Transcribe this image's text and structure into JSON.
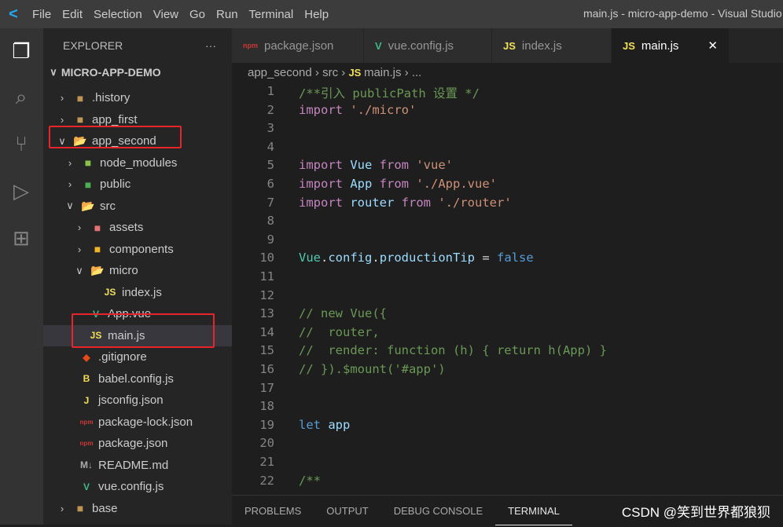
{
  "titlebar": {
    "menus": [
      "File",
      "Edit",
      "Selection",
      "View",
      "Go",
      "Run",
      "Terminal",
      "Help"
    ],
    "title": "main.js - micro-app-demo - Visual Studio Code"
  },
  "explorer": {
    "header": "EXPLORER",
    "more": "···",
    "root": "MICRO-APP-DEMO",
    "items": [
      {
        "label": ".history",
        "level": 1,
        "type": "folder",
        "open": false,
        "icon_color": "#c09553"
      },
      {
        "label": "app_first",
        "level": 1,
        "type": "folder",
        "open": false,
        "icon_color": "#c09553"
      },
      {
        "label": "app_second",
        "level": 1,
        "type": "folder",
        "open": true,
        "icon_color": "#c09553",
        "highlighted": true
      },
      {
        "label": "node_modules",
        "level": 2,
        "type": "folder",
        "open": false,
        "icon_color": "#8bc34a"
      },
      {
        "label": "public",
        "level": 2,
        "type": "folder",
        "open": false,
        "icon_color": "#4caf50"
      },
      {
        "label": "src",
        "level": 2,
        "type": "folder",
        "open": true,
        "icon_color": "#4caf50"
      },
      {
        "label": "assets",
        "level": 3,
        "type": "folder",
        "open": false,
        "icon_color": "#e57373"
      },
      {
        "label": "components",
        "level": 3,
        "type": "folder",
        "open": false,
        "icon_color": "#f0b429"
      },
      {
        "label": "micro",
        "level": 3,
        "type": "folder",
        "open": true,
        "icon_color": "#c09553"
      },
      {
        "label": "index.js",
        "level": 4,
        "type": "file",
        "icon": "JS",
        "icon_color": "#f1e05a"
      },
      {
        "label": "App.vue",
        "level": 3,
        "type": "file",
        "icon": "V",
        "icon_color": "#41b883"
      },
      {
        "label": "main.js",
        "level": 3,
        "type": "file",
        "icon": "JS",
        "icon_color": "#f1e05a",
        "selected": true,
        "highlighted": true
      },
      {
        "label": ".gitignore",
        "level": 2,
        "type": "file",
        "icon": "◆",
        "icon_color": "#e64a19"
      },
      {
        "label": "babel.config.js",
        "level": 2,
        "type": "file",
        "icon": "B",
        "icon_color": "#f5da55"
      },
      {
        "label": "jsconfig.json",
        "level": 2,
        "type": "file",
        "icon": "J",
        "icon_color": "#f1e05a"
      },
      {
        "label": "package-lock.json",
        "level": 2,
        "type": "file",
        "icon": "npm",
        "icon_color": "#cb3837"
      },
      {
        "label": "package.json",
        "level": 2,
        "type": "file",
        "icon": "npm",
        "icon_color": "#cb3837"
      },
      {
        "label": "README.md",
        "level": 2,
        "type": "file",
        "icon": "M↓",
        "icon_color": "#aaaaaa"
      },
      {
        "label": "vue.config.js",
        "level": 2,
        "type": "file",
        "icon": "V",
        "icon_color": "#41b883"
      },
      {
        "label": "base",
        "level": 1,
        "type": "folder",
        "open": false,
        "icon_color": "#c09553"
      }
    ]
  },
  "tabs": [
    {
      "label": "package.json",
      "icon": "npm",
      "icon_color": "#cb3837"
    },
    {
      "label": "vue.config.js",
      "icon": "V",
      "icon_color": "#41b883"
    },
    {
      "label": "index.js",
      "icon": "JS",
      "icon_color": "#f1e05a"
    },
    {
      "label": "main.js",
      "icon": "JS",
      "icon_color": "#f1e05a",
      "active": true,
      "close": "✕"
    }
  ],
  "breadcrumb": [
    "app_second",
    "src",
    "main.js",
    "..."
  ],
  "code": [
    [
      [
        "/**引入 publicPath 设置 */",
        "cm"
      ]
    ],
    [
      [
        "import ",
        "kw"
      ],
      [
        "'./micro'",
        "str"
      ]
    ],
    [],
    [],
    [
      [
        "import ",
        "kw"
      ],
      [
        "Vue ",
        "var"
      ],
      [
        "from ",
        "kw"
      ],
      [
        "'vue'",
        "str"
      ]
    ],
    [
      [
        "import ",
        "kw"
      ],
      [
        "App ",
        "var"
      ],
      [
        "from ",
        "kw"
      ],
      [
        "'./App.vue'",
        "str"
      ]
    ],
    [
      [
        "import ",
        "kw"
      ],
      [
        "router ",
        "var"
      ],
      [
        "from ",
        "kw"
      ],
      [
        "'./router'",
        "str"
      ]
    ],
    [],
    [],
    [
      [
        "Vue",
        "cls"
      ],
      [
        ".",
        "pl"
      ],
      [
        "config",
        "var"
      ],
      [
        ".",
        "pl"
      ],
      [
        "productionTip",
        "var"
      ],
      [
        " = ",
        "pl"
      ],
      [
        "false",
        "bool"
      ]
    ],
    [],
    [],
    [
      [
        "// new Vue({",
        "cm"
      ]
    ],
    [
      [
        "//  router,",
        "cm"
      ]
    ],
    [
      [
        "//  render: function (h) { return h(App) }",
        "cm"
      ]
    ],
    [
      [
        "// }).$mount('#app')",
        "cm"
      ]
    ],
    [],
    [],
    [
      [
        "let ",
        "bool"
      ],
      [
        "app",
        "var"
      ]
    ],
    [],
    [],
    [
      [
        "/**",
        "cm"
      ]
    ]
  ],
  "panel": {
    "tabs": [
      "PROBLEMS",
      "OUTPUT",
      "DEBUG CONSOLE",
      "TERMINAL"
    ],
    "active": "TERMINAL"
  },
  "watermark": "CSDN @笑到世界都狼狈"
}
